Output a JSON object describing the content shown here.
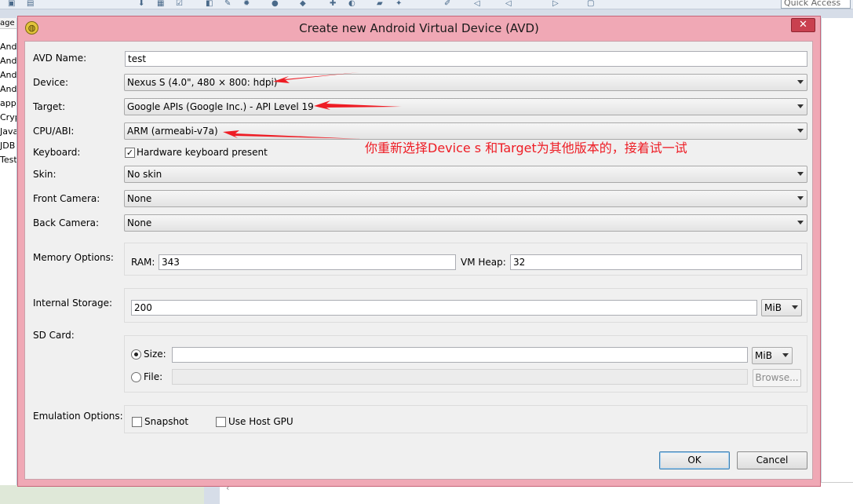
{
  "ide": {
    "quick_access": "Quick Access",
    "left_tab": "age",
    "left_rows": [
      "And",
      "And",
      "And",
      "And",
      "app",
      "Cryp",
      "Java",
      "JDB",
      "Test"
    ]
  },
  "dialog": {
    "title": "Create new Android Virtual Device (AVD)",
    "close_label": "✕",
    "avd_name_label": "AVD Name:",
    "avd_name_value": "test",
    "device_label": "Device:",
    "device_value": "Nexus S (4.0\", 480 × 800: hdpi)",
    "target_label": "Target:",
    "target_value": "Google APIs (Google Inc.) - API Level 19",
    "cpu_label": "CPU/ABI:",
    "cpu_value": "ARM (armeabi-v7a)",
    "keyboard_label": "Keyboard:",
    "keyboard_option": "Hardware keyboard present",
    "keyboard_checked": true,
    "skin_label": "Skin:",
    "skin_value": "No skin",
    "front_camera_label": "Front Camera:",
    "front_camera_value": "None",
    "back_camera_label": "Back Camera:",
    "back_camera_value": "None",
    "memory_label": "Memory Options:",
    "ram_label": "RAM:",
    "ram_value": "343",
    "vm_heap_label": "VM Heap:",
    "vm_heap_value": "32",
    "internal_storage_label": "Internal Storage:",
    "internal_storage_value": "200",
    "internal_storage_unit": "MiB",
    "sd_card_label": "SD Card:",
    "sd_size_label": "Size:",
    "sd_size_value": "",
    "sd_size_unit": "MiB",
    "sd_file_label": "File:",
    "browse_label": "Browse...",
    "emulation_label": "Emulation Options:",
    "snapshot_label": "Snapshot",
    "use_host_gpu_label": "Use Host GPU",
    "ok_label": "OK",
    "cancel_label": "Cancel"
  },
  "annotation": {
    "text": "你重新选择Device s 和Target为其他版本的，接着试一试",
    "color": "#ee1c24"
  }
}
